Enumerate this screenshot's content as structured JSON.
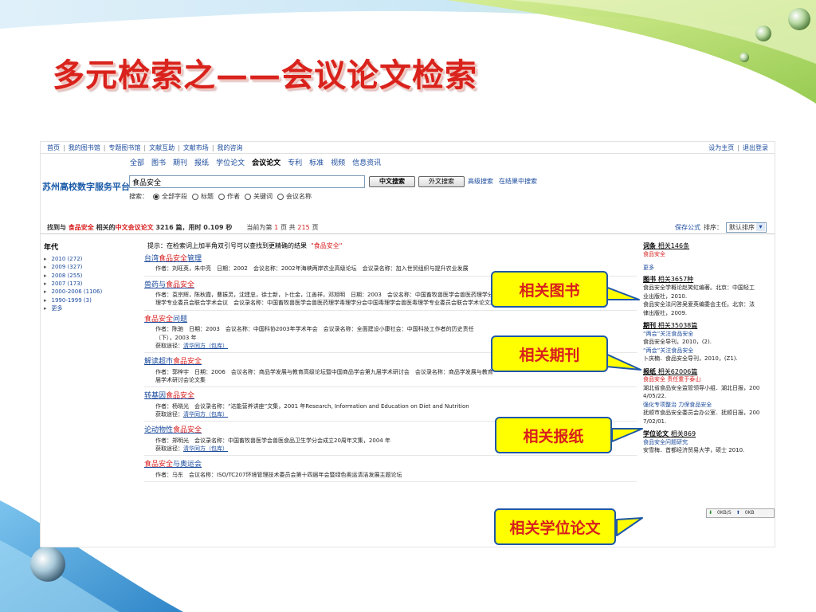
{
  "slide": {
    "title": "多元检索之——会议论文检索"
  },
  "topnav": {
    "left": [
      "首页",
      "我的图书馆",
      "专题图书馆",
      "文献互助",
      "文献市场",
      "我的咨询"
    ],
    "right": [
      "设为主页",
      "退出登录"
    ]
  },
  "brand": "苏州高校数字服务平台",
  "categories": [
    "全部",
    "图书",
    "期刊",
    "报纸",
    "学位论文",
    "会议论文",
    "专利",
    "标准",
    "视频",
    "信息资讯"
  ],
  "active_category": "会议论文",
  "search": {
    "value": "食品安全",
    "cn_button": "中文搜索",
    "fn_button": "外文搜索",
    "advanced_link": "高级搜索",
    "within_link": "在结果中搜索",
    "scope_label": "搜索：",
    "scopes": [
      "全部字段",
      "标题",
      "作者",
      "关键词",
      "会议名称"
    ],
    "scope_selected": "全部字段"
  },
  "result_bar": {
    "prefix": "找到与",
    "keyword": "食品安全",
    "middle": "相关的",
    "type": "中文会议论文",
    "count": "3216",
    "unit_time": "篇，用时",
    "time": "0.109",
    "sec": "秒",
    "page_prefix": "当前为第",
    "page": "1",
    "page_mid": "页 共",
    "total_pages": "215",
    "page_suffix": "页"
  },
  "sort": {
    "save_formula": "保存公式",
    "label": "排序：",
    "value": "默认排序"
  },
  "years": {
    "title": "年代",
    "items": [
      "2010 (272)",
      "2009 (327)",
      "2008 (255)",
      "2007 (173)",
      "2000-2006 (1106)",
      "1990-1999 (3)",
      "更多"
    ]
  },
  "tip": {
    "text": "提示：在检索词上加半角双引号可以查找到更精确的结果",
    "example": "\"食品安全\""
  },
  "results": [
    {
      "pre": "台湾",
      "hl": "食品安全",
      "post": "管理",
      "meta1": "作者：刘旺英，朱中亮　日期：2002　会议名称：2002年海峡两岸农业高级论坛　会议录名称：加入世贸组织与提升农业发展"
    },
    {
      "pre": "兽药与",
      "hl": "食品安全",
      "post": "",
      "meta1": "作者：袁宗辉，陈秋霞，曹振灵，沈建忠，徐士新，卜仕金，江善祥，邓旭明　日期：2003　会议名称：中国畜牧兽医学会兽医药理学分会",
      "meta2": "理学专业委员会联合学术会议　会议录名称：中国畜牧兽医学会兽医药理学毒理学分会中国毒理学会兽医毒理学专业委员会联合学术论文集"
    },
    {
      "pre": "",
      "hl": "食品安全",
      "post": "问题",
      "meta1": "作者：陈驰　日期：2003　会议名称：中国科协2003年学术年会　会议录名称：全面建设小康社会：中国科技工作者的历史责任",
      "meta2": "（下），2003 年",
      "get": "获取途径：",
      "link": "清华同方（包库）"
    },
    {
      "pre": "解读超市",
      "hl": "食品安全",
      "post": "",
      "meta1": "作者：郭梓宇　日期：2006　会议名称：商品学发展与教育高级论坛暨中国商品学会第九届学术研讨会　会议录名称：商品学发展与教育",
      "meta2": "届学术研讨会论文集"
    },
    {
      "pre": "转基因",
      "hl": "食品安全",
      "post": "",
      "meta1": "作者：杨晓光　会议录名称：“达能营养讲座”文集，2001 年Research, Information and Education on Diet and Nutrition",
      "get": "获取途径：",
      "link": "清华同方（包库）"
    },
    {
      "pre": "论动物性",
      "hl": "食品安全",
      "post": "",
      "meta1": "作者：郑明光　会议录名称：中国畜牧兽医学会兽医食品卫生学分会成立20周年文集，2004 年",
      "get": "获取途径：",
      "link": "清华同方（包库）"
    },
    {
      "pre": "",
      "hl": "食品安全",
      "post": "与奥运会",
      "meta1": "作者：马东　会议名称：ISO/TC207环境管理技术委员会第十四届年会暨绿色奥运清洁发展主题论坛"
    }
  ],
  "right_panel": {
    "terms": {
      "title": "词条",
      "count": "相关146条",
      "items": [
        "食品安全"
      ],
      "more": "更多"
    },
    "books": {
      "title": "图书",
      "count": "相关3657种",
      "items": [
        "食品安全学概论赵笑虹编著。北京：中国轻工",
        "业出版社，2010.",
        "食品安全法问答吴爱英编委会主任。北京：法",
        "律出版社，2009."
      ]
    },
    "journals": {
      "title": "期刊",
      "count": "相关35038篇",
      "items": [
        "“两会”关注食品安全",
        "食品安全导刊，2010，(2).",
        "“两会”关注食品安全",
        "卜庆楠．食品安全导刊，2010，(Z1)."
      ]
    },
    "papers": {
      "title": "报纸",
      "count": "相关62006篇",
      "items": [
        "食品安全 责任重于泰山",
        "湖北省食品安全监管领导小组．湖北日报，200",
        "4/05/22.",
        "强化专项整治 力保食品安全",
        "抚顺市食品安全委员会办公室．抚顺日报，200",
        "7/02/01."
      ]
    },
    "theses": {
      "title": "学位论文",
      "count": "相关869",
      "items": [
        "食品安全问题研究",
        "安雪梅．首都经济贸易大学，硕士 2010."
      ]
    },
    "net_speed": {
      "down": "0KB/S",
      "up": "0KB"
    }
  },
  "callouts": [
    "相关图书",
    "相关期刊",
    "相关报纸",
    "相关学位论文"
  ],
  "colors": {
    "title_red": "#d9221c",
    "link_blue": "#1a4a9c",
    "callout_yellow": "#ffff00",
    "callout_border": "#1e57a8"
  }
}
